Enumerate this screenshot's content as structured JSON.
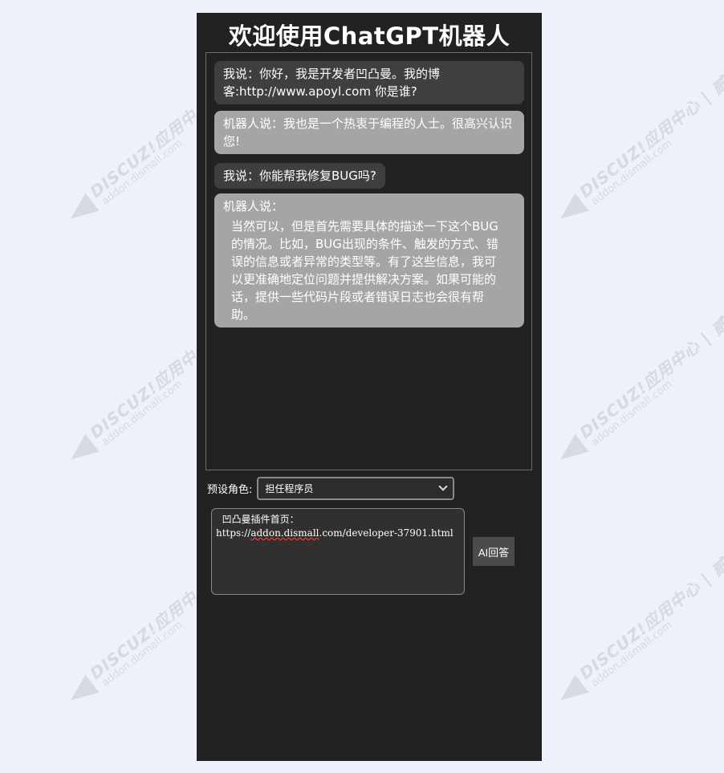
{
  "page": {
    "title": "欢迎使用ChatGPT机器人",
    "background": "#eef1f9",
    "panel_color": "#222222"
  },
  "messages": [
    {
      "role": "user",
      "text": "我说：你好，我是开发者凹凸曼。我的博客:http://www.apoyl.com 你是谁?"
    },
    {
      "role": "bot",
      "text": "机器人说：我也是一个热衷于编程的人士。很高兴认识您!"
    },
    {
      "role": "user",
      "text": "我说：你能帮我修复BUG吗?"
    },
    {
      "role": "bot",
      "speaker": "机器人说：",
      "text": "当然可以，但是首先需要具体的描述一下这个BUG的情况。比如，BUG出现的条件、触发的方式、错误的信息或者异常的类型等。有了这些信息，我可以更准确地定位问题并提供解决方案。如果可能的话，提供一些代码片段或者错误日志也会很有帮助。"
    }
  ],
  "role_select": {
    "label": "预设角色:",
    "selected": "担任程序员"
  },
  "prompt": {
    "line1": "  凹凸曼插件首页：",
    "url_start": "https://",
    "url_marked": "addon.dismall",
    "url_end": ".com/developer-37901.html"
  },
  "submit_button": {
    "label": "AI回答"
  },
  "watermark": {
    "brand": "DISCUZ!应用中心 | 贰道",
    "domain": "addon.dismall.com",
    "icon": "discuz-logo-icon"
  }
}
